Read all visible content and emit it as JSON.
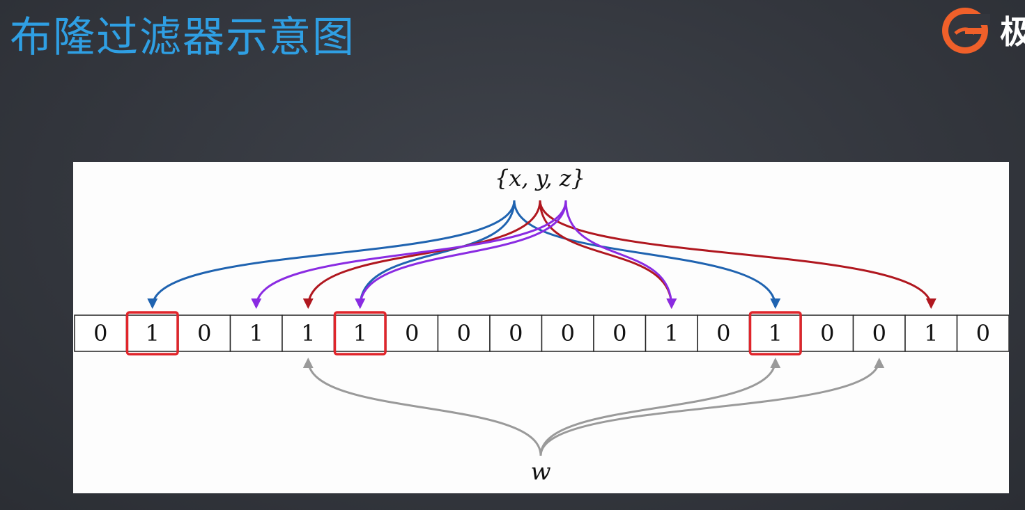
{
  "slide": {
    "title": "布隆过滤器示意图"
  },
  "logo": {
    "text": "极",
    "icon": "geekbang-logo-icon",
    "color": "#f0602a"
  },
  "diagram": {
    "set_label": "{x, y, z}",
    "query_label": "w",
    "bits": [
      "0",
      "1",
      "0",
      "1",
      "1",
      "1",
      "0",
      "0",
      "0",
      "0",
      "0",
      "1",
      "0",
      "1",
      "0",
      "0",
      "1",
      "0"
    ],
    "highlighted_indices": [
      1,
      5,
      13
    ],
    "element_colors": {
      "x": "#1f63b0",
      "y": "#b0171f",
      "z": "#8a2be2",
      "w": "#9a9a9a",
      "highlight": "#e0252b"
    },
    "mappings": {
      "x": [
        1,
        5,
        13
      ],
      "y": [
        4,
        11,
        16
      ],
      "z": [
        3,
        5,
        11
      ],
      "w": [
        4,
        13,
        15
      ]
    }
  }
}
